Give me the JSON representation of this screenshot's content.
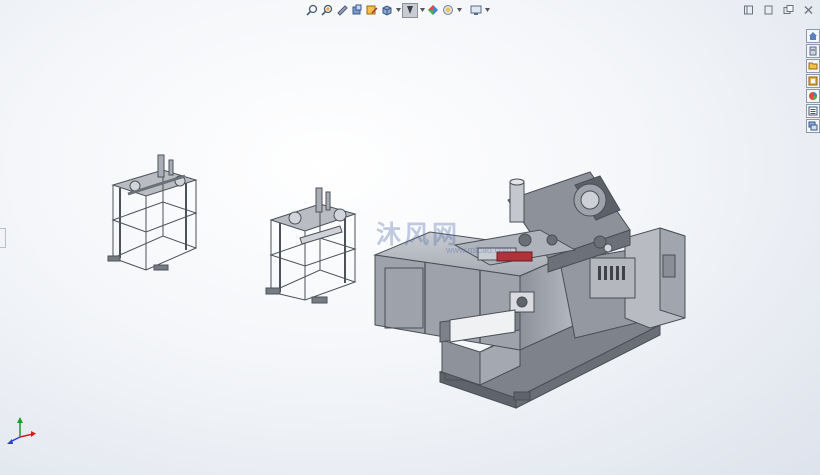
{
  "view_toolbar": {
    "buttons": [
      {
        "name": "zoom-to-fit",
        "icon": "magnifier-fit-icon"
      },
      {
        "name": "zoom-to-area",
        "icon": "magnifier-area-icon"
      },
      {
        "name": "previous-view",
        "icon": "previous-view-icon"
      },
      {
        "name": "section-view",
        "icon": "section-view-icon"
      },
      {
        "name": "dynamic-annotation",
        "icon": "annotation-icon"
      },
      {
        "name": "view-orientation",
        "icon": "cube-icon"
      },
      {
        "name": "display-style",
        "icon": "shaded-icon",
        "active": true
      },
      {
        "name": "hide-show-items",
        "icon": "eye-icon"
      },
      {
        "name": "edit-appearance",
        "icon": "appearance-icon"
      },
      {
        "name": "apply-scene",
        "icon": "scene-icon"
      },
      {
        "name": "view-settings",
        "icon": "monitor-icon"
      }
    ]
  },
  "window_controls": [
    "restore-pane-icon",
    "help-icon",
    "minimize-icon",
    "close-icon"
  ],
  "task_pane": [
    "home-icon",
    "parts-library-icon",
    "file-explorer-icon",
    "view-palette-icon",
    "appearances-icon",
    "custom-properties-icon",
    "forum-icon"
  ],
  "watermark": {
    "text": "沐风网",
    "url": "www.mfcad.com"
  },
  "colors": {
    "model": "#9a9ea8",
    "model_dark": "#5f636b",
    "model_light": "#c9ccd2",
    "accent": "#b0323a",
    "bg": "#f4f6f9"
  }
}
